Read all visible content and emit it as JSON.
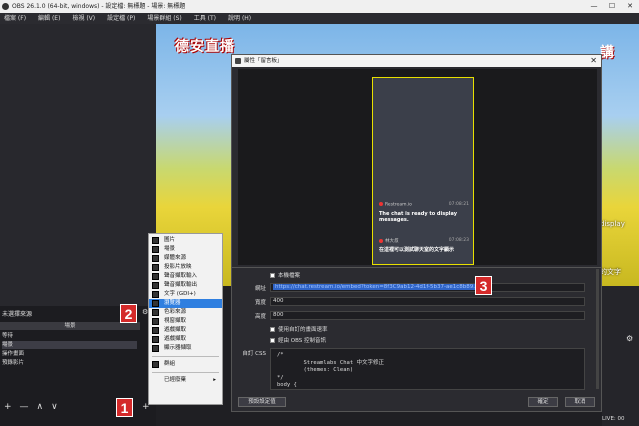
{
  "window": {
    "title": "OBS 26.1.0 (64-bit, windows) - 設定檔: 無標題 - 場景: 無標題",
    "controls": [
      "—",
      "☐",
      "✕"
    ]
  },
  "menu": [
    "檔案 (F)",
    "編輯 (E)",
    "檢視 (V)",
    "設定檔 (P)",
    "場景群組 (S)",
    "工具 (T)",
    "說明 (H)"
  ],
  "preview": {
    "banner": "德安直播",
    "banner_right": "講",
    "right_text1": "display",
    "right_text2": "的文字"
  },
  "scenes": {
    "header": "未選擇來源",
    "column": "場景",
    "items": [
      "等待",
      "場景",
      "操作畫面",
      "預錄影片"
    ]
  },
  "bottom_tools": [
    "+",
    "—",
    "∧",
    "∨"
  ],
  "sources_gear": "⚙",
  "sources_plus": "+",
  "context_menu": {
    "items": [
      "圖片",
      "場景",
      "媒體來源",
      "投影片放映",
      "聲音擷取輸入",
      "聲音擷取輸出",
      "文字 (GDI+)",
      "瀏覽器",
      "色彩來源",
      "視窗擷取",
      "遊戲擷取",
      "遊戲擷取",
      "顯示器擷取",
      "群組",
      "已經廢棄"
    ],
    "selected": "瀏覽器",
    "deprecated_arrow": "▸"
  },
  "dialog": {
    "title": "屬性「留言板」",
    "close": "✕",
    "chat": [
      {
        "name": "Restream.io",
        "time": "07:08:21",
        "text": "The chat is ready to display messages."
      },
      {
        "name": "林大叔",
        "time": "07:08:23",
        "text": "在這裡可以測試聊天室的文字顯示"
      }
    ],
    "local_file_label": "本機檔案",
    "url_label": "網址",
    "url_value": "https://chat.restream.io/embed?token=8f3C9ab12-4d1f-5b37-ae1c8b89...",
    "width_label": "寬度",
    "width_value": "400",
    "height_label": "高度",
    "height_value": "800",
    "custom_fps_label": "使用自訂的畫面速率",
    "obs_audio_label": "經由 OBS 控制音訊",
    "css_label": "自訂 CSS",
    "css_value": "/*\n        Streamlabs Chat 中文字修正\n        (themes: Clean)\n*/\nbody {",
    "defaults_button": "預設設定值",
    "ok_button": "確定",
    "cancel_button": "取消"
  },
  "badges": [
    "1",
    "2",
    "3"
  ],
  "status": {
    "live": "LIVE: 00"
  },
  "right_gear": "⚙"
}
